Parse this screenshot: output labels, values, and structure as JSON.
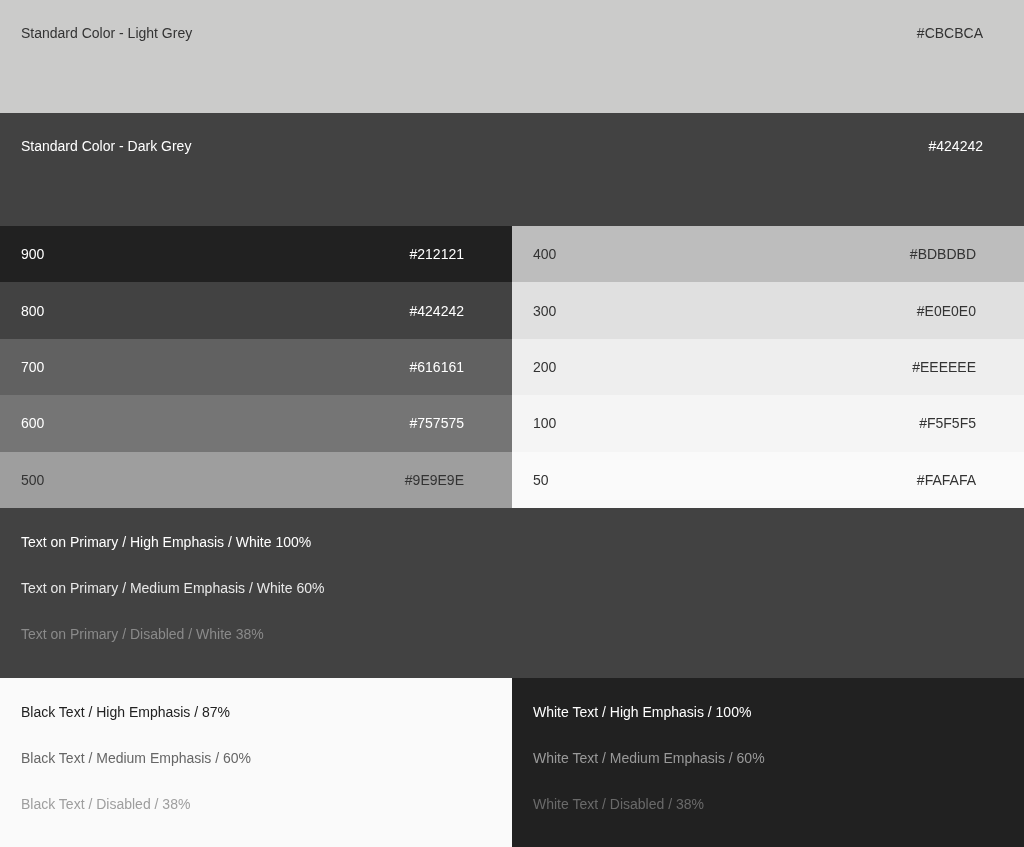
{
  "standard_colors": [
    {
      "label": "Standard Color - Light Grey",
      "hex": "#CBCBCA",
      "color": "#cbcbca"
    },
    {
      "label": "Standard Color - Dark Grey",
      "hex": "#424242",
      "color": "#424242"
    }
  ],
  "swatch_columns": [
    [
      {
        "shade": "900",
        "hex": "#212121",
        "color": "#212121"
      },
      {
        "shade": "800",
        "hex": "#424242",
        "color": "#424242"
      },
      {
        "shade": "700",
        "hex": "#616161",
        "color": "#616161"
      },
      {
        "shade": "600",
        "hex": "#757575",
        "color": "#757575"
      },
      {
        "shade": "500",
        "hex": "#9E9E9E",
        "color": "#9e9e9e"
      }
    ],
    [
      {
        "shade": "400",
        "hex": "#BDBDBD",
        "color": "#bdbdbd"
      },
      {
        "shade": "300",
        "hex": "#E0E0E0",
        "color": "#e0e0e0"
      },
      {
        "shade": "200",
        "hex": "#EEEEEE",
        "color": "#eeeeee"
      },
      {
        "shade": "100",
        "hex": "#F5F5F5",
        "color": "#f5f5f5"
      },
      {
        "shade": "50",
        "hex": "#FAFAFA",
        "color": "#fafafa"
      }
    ]
  ],
  "text_on_primary": [
    {
      "text": "Text on Primary / High Emphasis / White 100%",
      "kind": "high"
    },
    {
      "text": "Text on Primary / Medium Emphasis / White 60%",
      "kind": "medium"
    },
    {
      "text": "Text on Primary / Disabled / White 38%",
      "kind": "disabled"
    }
  ],
  "text_panels": [
    {
      "kind": "light",
      "lines": [
        {
          "text": "Black Text / High Emphasis / 87%",
          "kind": "high"
        },
        {
          "text": "Black Text / Medium Emphasis / 60%",
          "kind": "medium"
        },
        {
          "text": "Black Text /  Disabled / 38%",
          "kind": "disabled"
        }
      ]
    },
    {
      "kind": "dark",
      "lines": [
        {
          "text": "White Text / High Emphasis / 100%",
          "kind": "high"
        },
        {
          "text": "White Text / Medium Emphasis / 60%",
          "kind": "medium"
        },
        {
          "text": "White Text / Disabled / 38%",
          "kind": "disabled"
        }
      ]
    }
  ]
}
